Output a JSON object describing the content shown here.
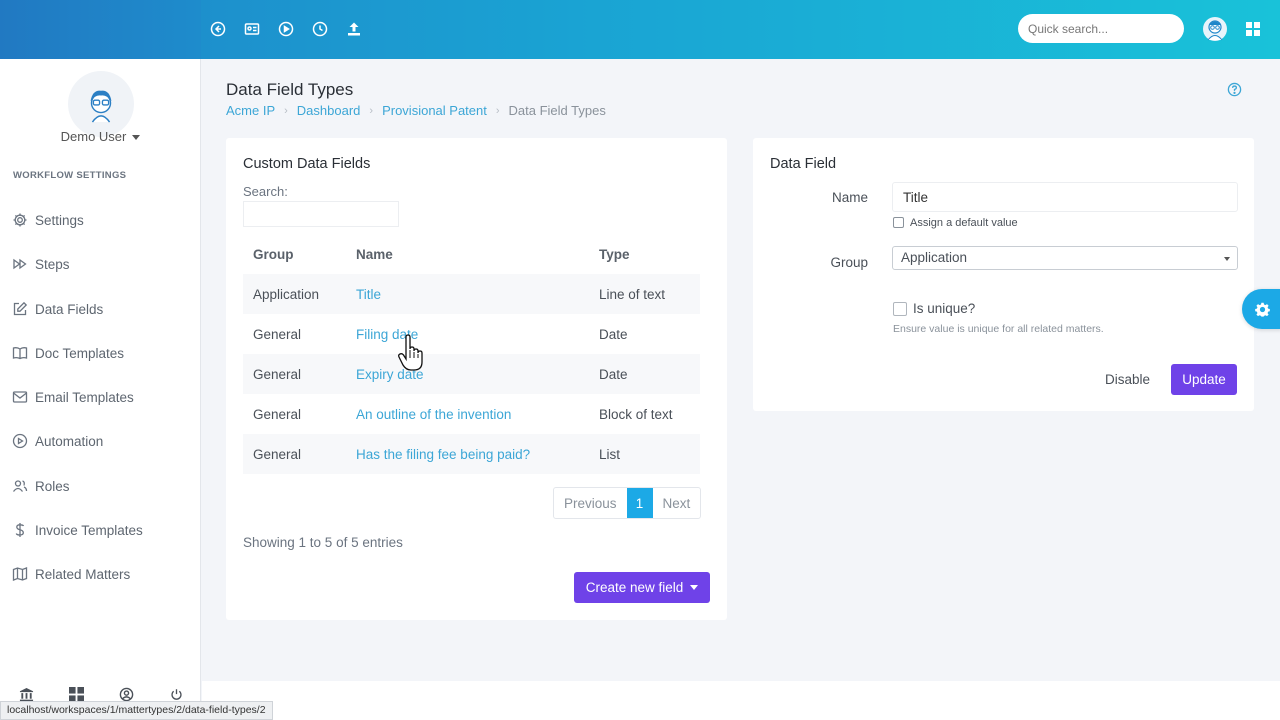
{
  "topbar": {
    "search_placeholder": "Quick search..."
  },
  "sidebar": {
    "user_name": "Demo User",
    "section_title": "WORKFLOW SETTINGS",
    "items": [
      {
        "label": "Settings",
        "icon": "gear-icon"
      },
      {
        "label": "Steps",
        "icon": "fast-forward-icon"
      },
      {
        "label": "Data Fields",
        "icon": "edit-icon"
      },
      {
        "label": "Doc Templates",
        "icon": "book-icon"
      },
      {
        "label": "Email Templates",
        "icon": "mail-icon"
      },
      {
        "label": "Automation",
        "icon": "play-circle-icon"
      },
      {
        "label": "Roles",
        "icon": "users-icon"
      },
      {
        "label": "Invoice Templates",
        "icon": "dollar-icon"
      },
      {
        "label": "Related Matters",
        "icon": "map-icon"
      }
    ]
  },
  "status_url": "localhost/workspaces/1/mattertypes/2/data-field-types/2",
  "page": {
    "title": "Data Field Types",
    "breadcrumb": [
      "Acme IP",
      "Dashboard",
      "Provisional Patent"
    ],
    "breadcrumb_current": "Data Field Types"
  },
  "left_card": {
    "title": "Custom Data Fields",
    "search_label": "Search:",
    "columns": [
      "Group",
      "Name",
      "Type"
    ],
    "rows": [
      {
        "group": "Application",
        "name": "Title",
        "type": "Line of text"
      },
      {
        "group": "General",
        "name": "Filing date",
        "type": "Date"
      },
      {
        "group": "General",
        "name": "Expiry date",
        "type": "Date"
      },
      {
        "group": "General",
        "name": "An outline of the invention",
        "type": "Block of text"
      },
      {
        "group": "General",
        "name": "Has the filing fee being paid?",
        "type": "List"
      }
    ],
    "pager": {
      "previous": "Previous",
      "page": "1",
      "next": "Next"
    },
    "info": "Showing 1 to 5 of 5 entries",
    "create_button": "Create new field"
  },
  "right_card": {
    "title": "Data Field",
    "name_label": "Name",
    "name_value": "Title",
    "default_value_label": "Assign a default value",
    "group_label": "Group",
    "group_value": "Application",
    "unique_label": "Is unique?",
    "unique_hint": "Ensure value is unique for all related matters.",
    "disable_button": "Disable",
    "update_button": "Update"
  },
  "colors": {
    "accent": "#1ca9e6",
    "primary_button": "#6f42e8",
    "link": "#3ca6d6"
  }
}
